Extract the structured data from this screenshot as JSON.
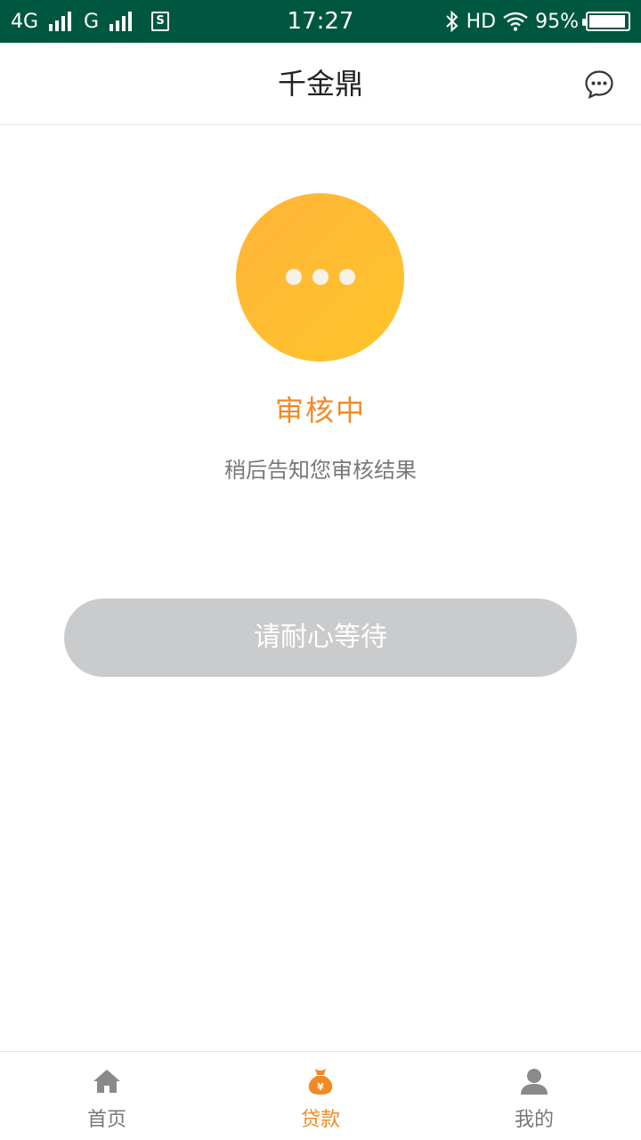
{
  "status_bar": {
    "network_1": "4G",
    "network_2": "G",
    "time": "17:27",
    "hd": "HD",
    "battery": "95%",
    "battery_level": 0.95
  },
  "header": {
    "title": "千金鼎",
    "message_icon": "chat-bubble-icon"
  },
  "review": {
    "icon": "more-dots-icon",
    "title": "审核中",
    "description": "稍后告知您审核结果",
    "button_label": "请耐心等待"
  },
  "tab_bar": {
    "items": [
      {
        "label": "首页",
        "icon": "home-icon",
        "active": false
      },
      {
        "label": "贷款",
        "icon": "money-bag-icon",
        "active": true
      },
      {
        "label": "我的",
        "icon": "user-icon",
        "active": false
      }
    ]
  },
  "colors": {
    "status_bar_bg": "#00573f",
    "accent": "#f08a24",
    "circle_start": "#ffb43a",
    "circle_end": "#ffc52a",
    "button_disabled": "#cacbcd",
    "tab_inactive": "#8a8a8a"
  }
}
